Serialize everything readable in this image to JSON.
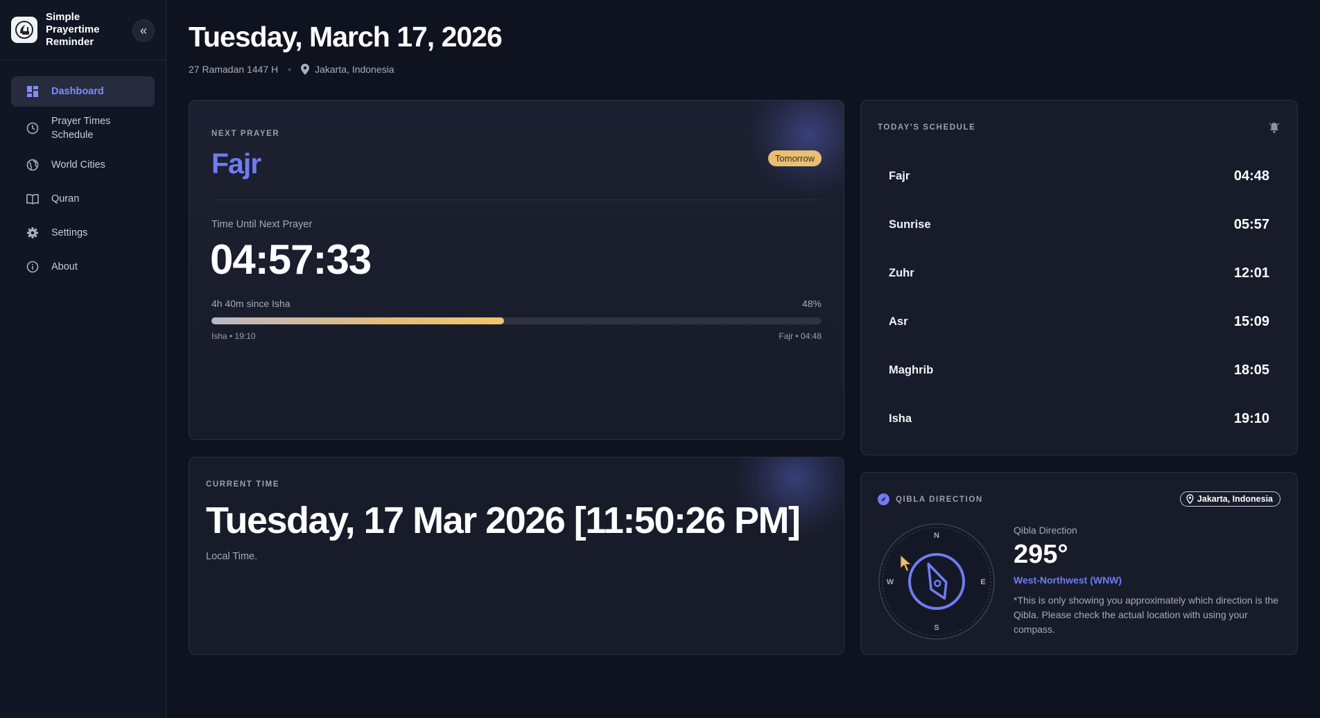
{
  "app": {
    "name": "Simple\nPrayertime\nReminder",
    "collapse_icon": "chevrons-left-icon"
  },
  "sidebar": {
    "items": [
      {
        "label": "Dashboard",
        "icon": "dashboard-icon",
        "active": true
      },
      {
        "label": "Prayer Times Schedule",
        "icon": "clock-icon",
        "active": false
      },
      {
        "label": "World Cities",
        "icon": "globe-icon",
        "active": false
      },
      {
        "label": "Quran",
        "icon": "book-icon",
        "active": false
      },
      {
        "label": "Settings",
        "icon": "gear-icon",
        "active": false
      },
      {
        "label": "About",
        "icon": "info-icon",
        "active": false
      }
    ]
  },
  "header": {
    "date": "Tuesday, March 17, 2026",
    "hijri": "27 Ramadan 1447 H",
    "location": "Jakarta, Indonesia"
  },
  "next_prayer": {
    "eyebrow": "NEXT PRAYER",
    "name": "Fajr",
    "badge": "Tomorrow",
    "countdown_label": "Time Until Next Prayer",
    "countdown": "04:57:33",
    "since": "4h 40m since Isha",
    "progress_text": "48%",
    "progress": 0.48,
    "start_label": "Isha • 19:10",
    "end_label": "Fajr • 04:48"
  },
  "current_time": {
    "eyebrow": "CURRENT TIME",
    "value": "Tuesday, 17 Mar 2026 [11:50:26 PM]",
    "sub": "Local Time."
  },
  "schedule": {
    "eyebrow": "TODAY'S SCHEDULE",
    "bell_icon": "bell-icon",
    "rows": [
      {
        "name": "Fajr",
        "time": "04:48"
      },
      {
        "name": "Sunrise",
        "time": "05:57"
      },
      {
        "name": "Zuhr",
        "time": "12:01"
      },
      {
        "name": "Asr",
        "time": "15:09"
      },
      {
        "name": "Maghrib",
        "time": "18:05"
      },
      {
        "name": "Isha",
        "time": "19:10"
      }
    ]
  },
  "qibla": {
    "eyebrow": "QIBLA DIRECTION",
    "location": "Jakarta, Indonesia",
    "label": "Qibla Direction",
    "degrees": "295°",
    "direction": "West-Northwest (WNW)",
    "note": "*This is only showing you approximately which direction is the Qibla. Please check the actual location with using your compass.",
    "compass": {
      "n": "N",
      "e": "E",
      "s": "S",
      "w": "W"
    }
  },
  "colors": {
    "accent": "#6f7cf2",
    "badge": "#e9bf73",
    "background": "#0f1320",
    "card": "#181c2a"
  }
}
